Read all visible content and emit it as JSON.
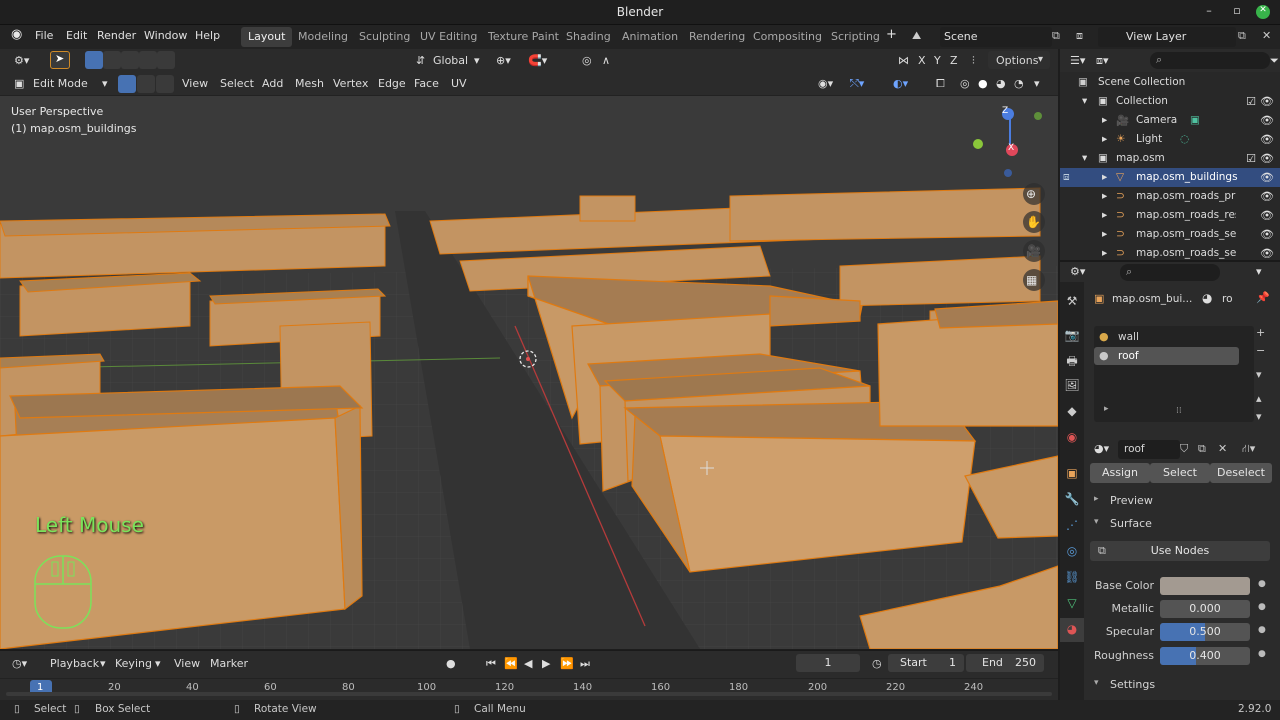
{
  "window": {
    "title": "Blender",
    "min": "–",
    "max": "▫",
    "close": "✕"
  },
  "menu": [
    "File",
    "Edit",
    "Render",
    "Window",
    "Help"
  ],
  "workspaces": [
    "Layout",
    "Modeling",
    "Sculpting",
    "UV Editing",
    "Texture Paint",
    "Shading",
    "Animation",
    "Rendering",
    "Compositing",
    "Scripting"
  ],
  "workspace_add": "+",
  "scene": "Scene",
  "view_layer": "View Layer",
  "viewport_header": {
    "transform_orientation": "Global",
    "axes": [
      "X",
      "Y",
      "Z"
    ],
    "options": "Options",
    "mode": "Edit Mode",
    "menus": [
      "View",
      "Select",
      "Add",
      "Mesh",
      "Vertex",
      "Edge",
      "Face",
      "UV"
    ]
  },
  "viewport": {
    "perspective": "User Perspective",
    "object": "(1) map.osm_buildings",
    "key_hint": "Left Mouse"
  },
  "outliner": {
    "rows": [
      {
        "label": "Scene Collection",
        "indent": 0,
        "icon": "scene-collection-icon"
      },
      {
        "label": "Collection",
        "indent": 1,
        "icon": "collection-icon"
      },
      {
        "label": "Camera",
        "indent": 2,
        "icon": "camera-icon"
      },
      {
        "label": "Light",
        "indent": 2,
        "icon": "light-icon"
      },
      {
        "label": "map.osm",
        "indent": 1,
        "icon": "collection-icon"
      },
      {
        "label": "map.osm_buildings",
        "indent": 2,
        "icon": "mesh-icon",
        "selected": true
      },
      {
        "label": "map.osm_roads_prim",
        "indent": 2,
        "icon": "curve-icon"
      },
      {
        "label": "map.osm_roads_resi",
        "indent": 2,
        "icon": "curve-icon"
      },
      {
        "label": "map.osm_roads_seco",
        "indent": 2,
        "icon": "curve-icon"
      },
      {
        "label": "map.osm_roads_serv",
        "indent": 2,
        "icon": "curve-icon"
      }
    ]
  },
  "properties": {
    "object": "map.osm_bui...",
    "material_short": "ro",
    "slots": [
      "wall",
      "roof"
    ],
    "active_material": "roof",
    "buttons": {
      "assign": "Assign",
      "select": "Select",
      "deselect": "Deselect"
    },
    "panels": {
      "preview": "Preview",
      "surface": "Surface",
      "settings": "Settings"
    },
    "use_nodes": "Use Nodes",
    "base_color_label": "Base Color",
    "base_color": "#a39a91",
    "metallic_label": "Metallic",
    "metallic": "0.000",
    "specular_label": "Specular",
    "specular": "0.500",
    "specular_value": 0.5,
    "roughness_label": "Roughness",
    "roughness": "0.400",
    "roughness_value": 0.4
  },
  "timeline": {
    "menus": [
      "Playback",
      "Keying",
      "View",
      "Marker"
    ],
    "current_frame": "1",
    "start_label": "Start",
    "start": "1",
    "end_label": "End",
    "end": "250",
    "ticks": [
      "1",
      "20",
      "40",
      "60",
      "80",
      "100",
      "120",
      "140",
      "160",
      "180",
      "200",
      "220",
      "240"
    ]
  },
  "statusbar": {
    "select": "Select",
    "box_select": "Box Select",
    "rotate_view": "Rotate View",
    "call_menu": "Call Menu",
    "version": "2.92.0"
  },
  "colors": {
    "accent": "#4772b3",
    "selection": "#334d80",
    "building": "#c99a66",
    "vertex": "#ff8a00",
    "key_hint": "#7be35a"
  }
}
